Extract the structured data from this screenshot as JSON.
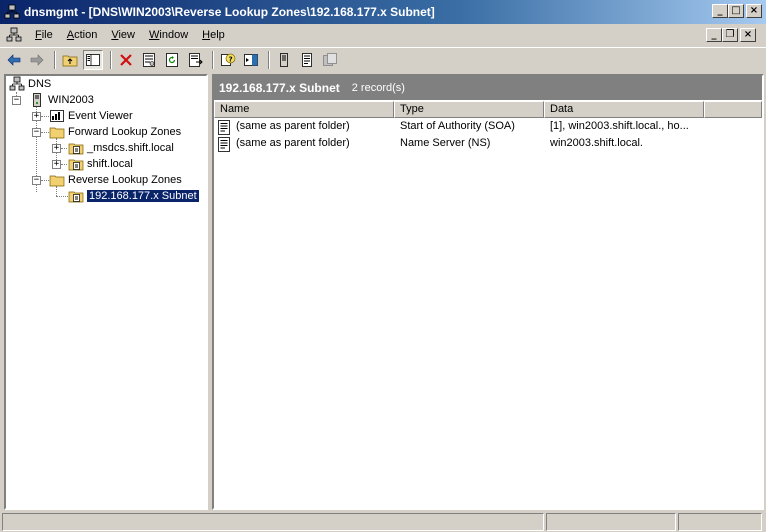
{
  "window": {
    "title": "dnsmgmt - [DNS\\WIN2003\\Reverse Lookup Zones\\192.168.177.x Subnet]"
  },
  "menu": {
    "items": [
      {
        "label": "File",
        "accel": "F"
      },
      {
        "label": "Action",
        "accel": "A"
      },
      {
        "label": "View",
        "accel": "V"
      },
      {
        "label": "Window",
        "accel": "W"
      },
      {
        "label": "Help",
        "accel": "H"
      }
    ]
  },
  "toolbar": {
    "icons": [
      "back-arrow-icon",
      "forward-arrow-icon",
      "up-folder-icon",
      "show-hide-tree-icon",
      "delete-icon",
      "properties-icon",
      "refresh-icon",
      "export-list-icon",
      "help-icon",
      "action-pane-icon",
      "new-record-icon",
      "new-host-icon",
      "new-alias-icon"
    ]
  },
  "tree": {
    "root": "DNS",
    "server": "WIN2003",
    "event_viewer": "Event Viewer",
    "forward_zones": "Forward Lookup Zones",
    "msdcs": "_msdcs.shift.local",
    "shift_local": "shift.local",
    "reverse_zones": "Reverse Lookup Zones",
    "subnet": "192.168.177.x Subnet"
  },
  "details": {
    "title": "192.168.177.x Subnet",
    "count": "2 record(s)",
    "columns": [
      "Name",
      "Type",
      "Data"
    ],
    "rows": [
      {
        "name": "(same as parent folder)",
        "type": "Start of Authority (SOA)",
        "data": "[1], win2003.shift.local., ho..."
      },
      {
        "name": "(same as parent folder)",
        "type": "Name Server (NS)",
        "data": "win2003.shift.local."
      }
    ]
  },
  "colors": {
    "titlebar_start": "#0a246a",
    "titlebar_end": "#a6caf0",
    "face": "#d4d0c8",
    "selection": "#0a246a",
    "header_gray": "#808080"
  }
}
